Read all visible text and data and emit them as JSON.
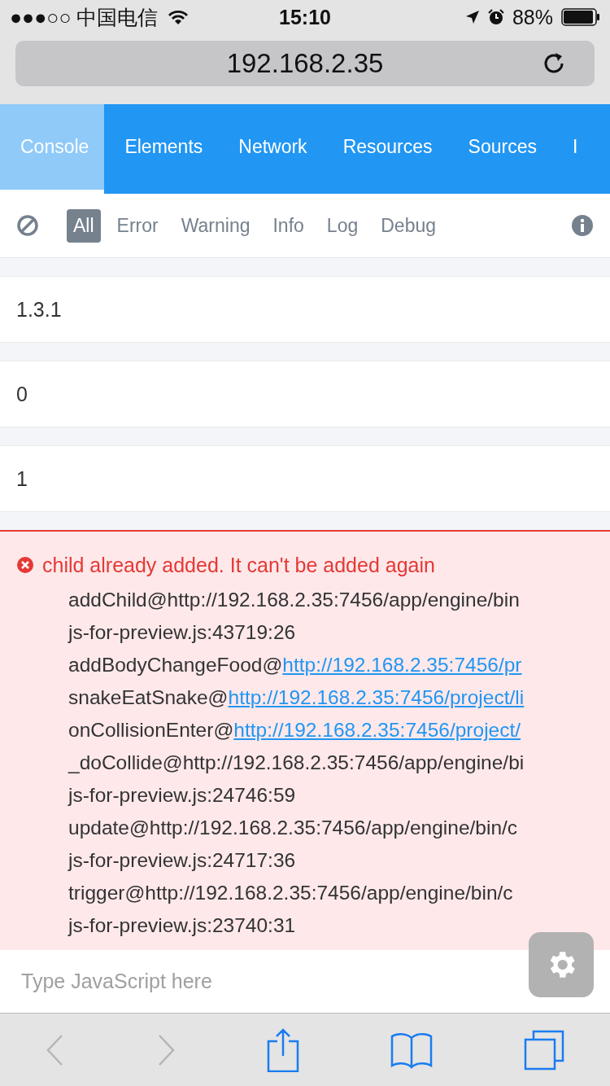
{
  "status_bar": {
    "carrier": "●●●○○ 中国电信",
    "time": "15:10",
    "battery": "88%"
  },
  "address_bar": {
    "url": "192.168.2.35"
  },
  "tabs": [
    {
      "label": "Console",
      "selected": true
    },
    {
      "label": "Elements",
      "selected": false
    },
    {
      "label": "Network",
      "selected": false
    },
    {
      "label": "Resources",
      "selected": false
    },
    {
      "label": "Sources",
      "selected": false
    },
    {
      "label": "I",
      "selected": false
    }
  ],
  "filters": [
    {
      "label": "All",
      "selected": true
    },
    {
      "label": "Error",
      "selected": false
    },
    {
      "label": "Warning",
      "selected": false
    },
    {
      "label": "Info",
      "selected": false
    },
    {
      "label": "Log",
      "selected": false
    },
    {
      "label": "Debug",
      "selected": false
    }
  ],
  "logs": [
    {
      "text": "1.3.1"
    },
    {
      "text": "0"
    },
    {
      "text": "1"
    }
  ],
  "error": {
    "message": "child already added. It can't be added again",
    "stack": [
      {
        "text": "addChild@http://192.168.2.35:7456/app/engine/bin"
      },
      {
        "text": "js-for-preview.js:43719:26"
      },
      {
        "text": "addBodyChangeFood@",
        "link": "http://192.168.2.35:7456/pr"
      },
      {
        "text": "snakeEatSnake@",
        "link": "http://192.168.2.35:7456/project/li"
      },
      {
        "text": "onCollisionEnter@",
        "link": "http://192.168.2.35:7456/project/"
      },
      {
        "text": "_doCollide@http://192.168.2.35:7456/app/engine/bi"
      },
      {
        "text": "js-for-preview.js:24746:59"
      },
      {
        "text": "update@http://192.168.2.35:7456/app/engine/bin/c"
      },
      {
        "text": "js-for-preview.js:24717:36"
      },
      {
        "text": "trigger@http://192.168.2.35:7456/app/engine/bin/c"
      },
      {
        "text": "js-for-preview.js:23740:31"
      }
    ]
  },
  "command_input": {
    "placeholder": "Type JavaScript here"
  }
}
